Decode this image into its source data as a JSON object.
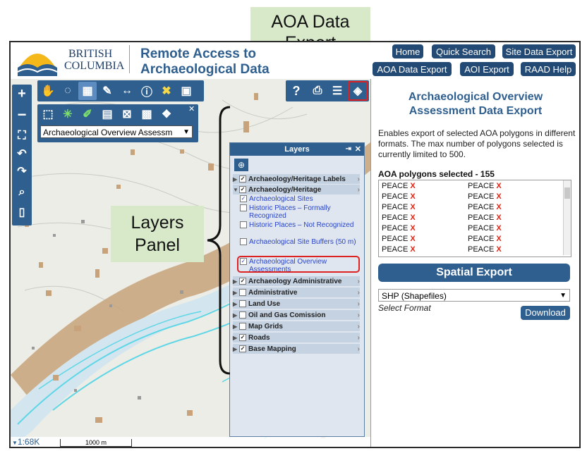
{
  "callouts": {
    "aoa_line1": "AOA Data",
    "aoa_line2": "Export",
    "layers_line1": "Layers",
    "layers_line2": "Panel"
  },
  "header": {
    "logo_line1": "BRITISH",
    "logo_line2": "COLUMBIA",
    "title_line1": "Remote Access to",
    "title_line2": "Archaeological Data"
  },
  "nav": {
    "home": "Home",
    "quick_search": "Quick Search",
    "site_data_export": "Site Data Export",
    "aoa_data_export": "AOA Data Export",
    "aoi_export": "AOI Export",
    "raad_help": "RAAD Help"
  },
  "selection_tool": {
    "selected": "Archaeological Overview Assessm"
  },
  "layers_panel": {
    "title": "Layers",
    "groups": [
      {
        "label": "Archaeology/Heritage Labels",
        "checked": true
      },
      {
        "label": "Archaeology/Heritage",
        "checked": true
      },
      {
        "label": "Archaeology Administrative",
        "checked": true
      },
      {
        "label": "Administrative",
        "checked": false
      },
      {
        "label": "Land Use",
        "checked": false
      },
      {
        "label": "Oil and Gas Comission",
        "checked": false
      },
      {
        "label": "Map Grids",
        "checked": false
      },
      {
        "label": "Roads",
        "checked": true
      },
      {
        "label": "Base Mapping",
        "checked": true
      }
    ],
    "sublayers": [
      {
        "label": "Archaeological Sites",
        "checked": true
      },
      {
        "label": "Historic Places – Formally Recognized",
        "checked": false
      },
      {
        "label": "Historic Places – Not Recognized",
        "checked": false
      },
      {
        "label": "Archaeological Site Buffers (50 m)",
        "checked": false
      },
      {
        "label": "Archaeological Overview Assessments",
        "checked": true
      }
    ]
  },
  "right_panel": {
    "title_line1": "Archaeological Overview",
    "title_line2": "Assessment Data Export",
    "description": "Enables export of selected AOA polygons in different formats. The max number of polygons selected is currently limited to 500.",
    "selected_label": "AOA polygons selected - 155",
    "polygon_name": "PEACE",
    "remove_mark": "X",
    "spatial_export": "Spatial Export",
    "format_selected": "SHP (Shapefiles)",
    "format_hint": "Select Format",
    "download": "Download"
  },
  "map_footer": {
    "scale_ratio": "1:68K",
    "scale_bar": "1000 m"
  },
  "colors": {
    "toolbar_blue": "#2f5f8f",
    "nav_blue": "#234a74",
    "polygon_tan": "#c8a27a",
    "river_cyan": "#5fd6e6",
    "highlight_red": "#d22"
  }
}
